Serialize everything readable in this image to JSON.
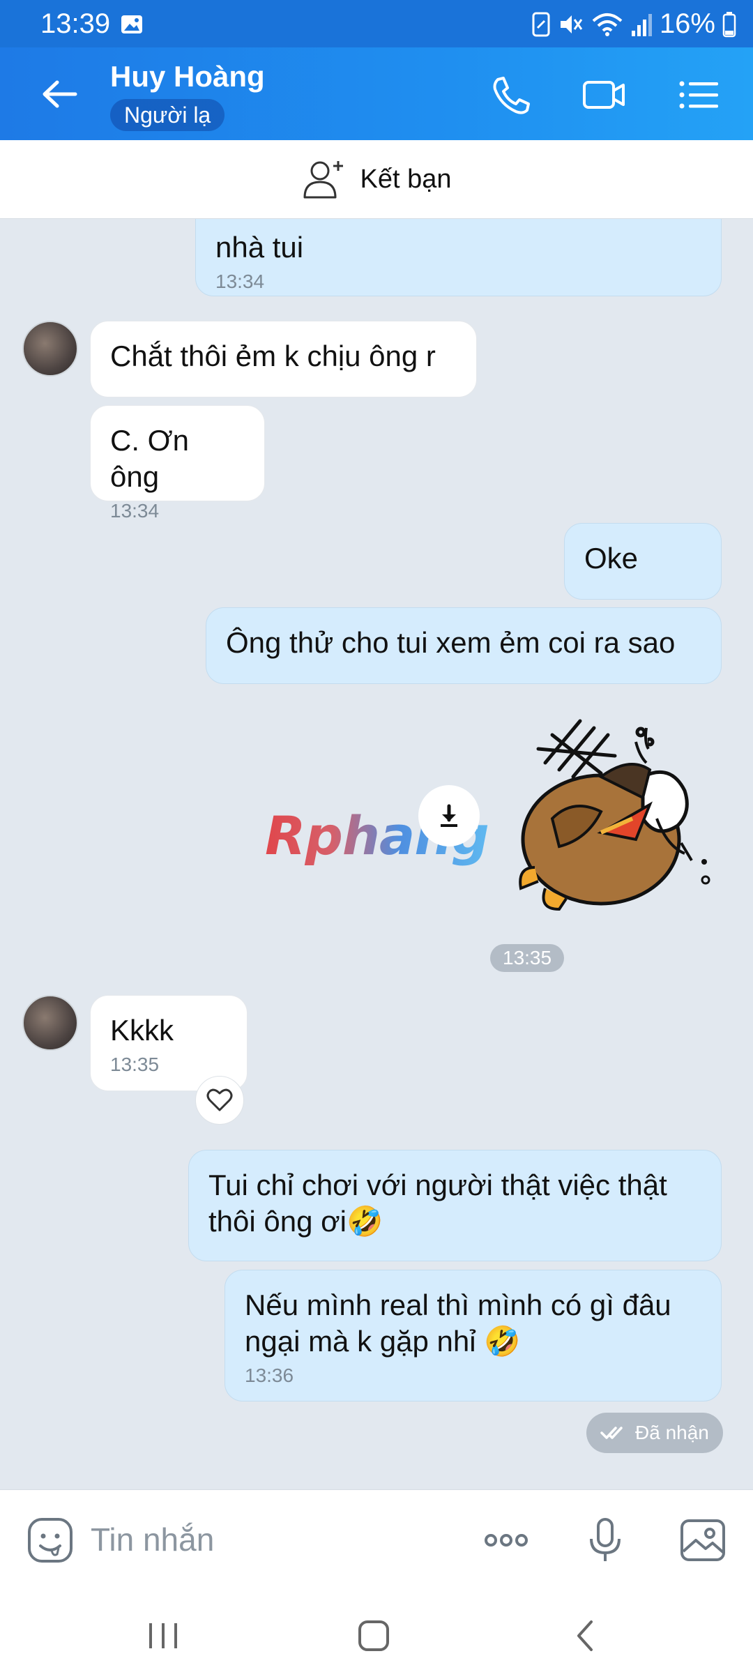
{
  "status_bar": {
    "time": "13:39",
    "battery": "16%"
  },
  "header": {
    "name": "Huy Hoàng",
    "badge": "Người lạ"
  },
  "add_friend": {
    "label": "Kết bạn"
  },
  "messages": {
    "m1": {
      "text": "nhà tui",
      "time": "13:34"
    },
    "m2": {
      "text": "Chắt thôi ẻm k chịu ông r"
    },
    "m3": {
      "text": "C. Ơn ông",
      "time": "13:34"
    },
    "m4": {
      "text": "Oke"
    },
    "m5": {
      "text": "Ông thử cho tui xem ẻm coi ra sao"
    },
    "sticker_time": "13:35",
    "m6": {
      "text": "Kkkk",
      "time": "13:35"
    },
    "m7": {
      "text": "Tui chỉ chơi với người thật việc thật thôi ông ơi🤣"
    },
    "m8": {
      "text": "Nếu mình real thì mình có gì đâu ngại mà k gặp nhỉ 🤣",
      "time": "13:36"
    },
    "delivery_status": "Đã nhận"
  },
  "watermark": "Rphang",
  "input": {
    "placeholder": "Tin nhắn"
  },
  "colors": {
    "header_start": "#1e7ae6",
    "header_end": "#24a2f6",
    "outgoing_bubble": "#d5ecfd",
    "incoming_bubble": "#ffffff",
    "chat_bg": "#e2e8ef"
  },
  "icons": [
    "back-arrow-icon",
    "phone-icon",
    "video-call-icon",
    "menu-list-icon",
    "add-friend-icon",
    "download-icon",
    "heart-icon",
    "double-check-icon",
    "sticker-emoji-icon",
    "more-icon",
    "microphone-icon",
    "image-icon",
    "nav-recent-icon",
    "nav-home-icon",
    "nav-back-icon"
  ]
}
